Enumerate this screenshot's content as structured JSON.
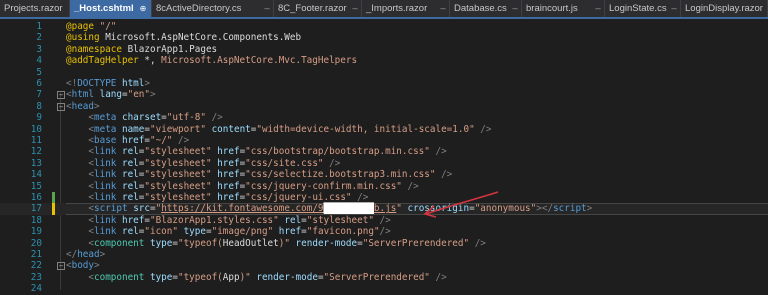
{
  "tabs": [
    {
      "label": "Projects.razor",
      "active": false
    },
    {
      "label": "_Host.cshtml",
      "active": true
    },
    {
      "label": "8cActiveDirectory.cs",
      "active": false
    },
    {
      "label": "8C_Footer.razor",
      "active": false
    },
    {
      "label": "_Imports.razor",
      "active": false
    },
    {
      "label": "Database.cs",
      "active": false
    },
    {
      "label": "braincourt.js",
      "active": false
    },
    {
      "label": "LoginState.cs",
      "active": false
    },
    {
      "label": "LoginDisplay.razor",
      "active": false
    }
  ],
  "tab_icons": {
    "pin": "⊕",
    "close": "✕",
    "separator": "–"
  },
  "colors": {
    "razor_directive": "#e8c100",
    "keyword": "#569cd6",
    "attribute": "#9cdcfe",
    "string": "#d69d85",
    "tag_bracket": "#808080",
    "component": "#4ec9b0",
    "text": "#dcdcdc",
    "line_number": "#2b91af",
    "annotation_arrow": "#d3343e"
  },
  "code_lines": [
    {
      "n": "1",
      "chg": "",
      "fold": "",
      "tokens": [
        [
          "@page",
          "d"
        ],
        [
          " \"/\"",
          "s"
        ]
      ]
    },
    {
      "n": "2",
      "chg": "",
      "fold": "",
      "tokens": [
        [
          "@using",
          "d"
        ],
        [
          " Microsoft.AspNetCore.Components.Web",
          "t"
        ]
      ]
    },
    {
      "n": "3",
      "chg": "",
      "fold": "",
      "tokens": [
        [
          "@namespace",
          "d"
        ],
        [
          " BlazorApp1.Pages",
          "t"
        ]
      ]
    },
    {
      "n": "4",
      "chg": "",
      "fold": "",
      "tokens": [
        [
          "@addTagHelper",
          "d"
        ],
        [
          " *, ",
          "t"
        ],
        [
          "Microsoft.AspNetCore.Mvc.TagHelpers",
          "s"
        ]
      ]
    },
    {
      "n": "5",
      "chg": "",
      "fold": "",
      "tokens": []
    },
    {
      "n": "6",
      "chg": "",
      "fold": "",
      "tokens": [
        [
          "<!",
          "p"
        ],
        [
          "DOCTYPE",
          "k"
        ],
        [
          " html",
          "a"
        ],
        [
          ">",
          "p"
        ]
      ]
    },
    {
      "n": "7",
      "chg": "",
      "fold": "−",
      "tokens": [
        [
          "<",
          "p"
        ],
        [
          "html",
          "k"
        ],
        [
          " lang",
          "a"
        ],
        [
          "=",
          "t"
        ],
        [
          "\"en\"",
          "s"
        ],
        [
          ">",
          "p"
        ]
      ]
    },
    {
      "n": "8",
      "chg": "",
      "fold": "−",
      "tokens": [
        [
          "<",
          "p"
        ],
        [
          "head",
          "k"
        ],
        [
          ">",
          "p"
        ]
      ]
    },
    {
      "n": "9",
      "chg": "",
      "fold": "",
      "tokens": [
        [
          "    ",
          "t"
        ],
        [
          "<",
          "p"
        ],
        [
          "meta",
          "k"
        ],
        [
          " charset",
          "a"
        ],
        [
          "=",
          "t"
        ],
        [
          "\"utf-8\"",
          "s"
        ],
        [
          " />",
          "p"
        ]
      ]
    },
    {
      "n": "10",
      "chg": "",
      "fold": "",
      "tokens": [
        [
          "    ",
          "t"
        ],
        [
          "<",
          "p"
        ],
        [
          "meta",
          "k"
        ],
        [
          " name",
          "a"
        ],
        [
          "=",
          "t"
        ],
        [
          "\"viewport\"",
          "s"
        ],
        [
          " content",
          "a"
        ],
        [
          "=",
          "t"
        ],
        [
          "\"width=device-width, initial-scale=1.0\"",
          "s"
        ],
        [
          " />",
          "p"
        ]
      ]
    },
    {
      "n": "11",
      "chg": "",
      "fold": "",
      "tokens": [
        [
          "    ",
          "t"
        ],
        [
          "<",
          "p"
        ],
        [
          "base",
          "k"
        ],
        [
          " href",
          "a"
        ],
        [
          "=",
          "t"
        ],
        [
          "\"~/\"",
          "s"
        ],
        [
          " />",
          "p"
        ]
      ]
    },
    {
      "n": "12",
      "chg": "",
      "fold": "",
      "tokens": [
        [
          "    ",
          "t"
        ],
        [
          "<",
          "p"
        ],
        [
          "link",
          "k"
        ],
        [
          " rel",
          "a"
        ],
        [
          "=",
          "t"
        ],
        [
          "\"stylesheet\"",
          "s"
        ],
        [
          " href",
          "a"
        ],
        [
          "=",
          "t"
        ],
        [
          "\"css/bootstrap/bootstrap.min.css\"",
          "s"
        ],
        [
          " />",
          "p"
        ]
      ]
    },
    {
      "n": "13",
      "chg": "",
      "fold": "",
      "tokens": [
        [
          "    ",
          "t"
        ],
        [
          "<",
          "p"
        ],
        [
          "link",
          "k"
        ],
        [
          " rel",
          "a"
        ],
        [
          "=",
          "t"
        ],
        [
          "\"stylesheet\"",
          "s"
        ],
        [
          " href",
          "a"
        ],
        [
          "=",
          "t"
        ],
        [
          "\"css/site.css\"",
          "s"
        ],
        [
          " />",
          "p"
        ]
      ]
    },
    {
      "n": "14",
      "chg": "",
      "fold": "",
      "tokens": [
        [
          "    ",
          "t"
        ],
        [
          "<",
          "p"
        ],
        [
          "link",
          "k"
        ],
        [
          " rel",
          "a"
        ],
        [
          "=",
          "t"
        ],
        [
          "\"stylesheet\"",
          "s"
        ],
        [
          " href",
          "a"
        ],
        [
          "=",
          "t"
        ],
        [
          "\"css/selectize.bootstrap3.min.css\"",
          "s"
        ],
        [
          " />",
          "p"
        ]
      ]
    },
    {
      "n": "15",
      "chg": "",
      "fold": "",
      "tokens": [
        [
          "    ",
          "t"
        ],
        [
          "<",
          "p"
        ],
        [
          "link",
          "k"
        ],
        [
          " rel",
          "a"
        ],
        [
          "=",
          "t"
        ],
        [
          "\"stylesheet\"",
          "s"
        ],
        [
          " href",
          "a"
        ],
        [
          "=",
          "t"
        ],
        [
          "\"css/jquery-confirm.min.css\"",
          "s"
        ],
        [
          " />",
          "p"
        ]
      ]
    },
    {
      "n": "16",
      "chg": "saved",
      "fold": "",
      "tokens": [
        [
          "    ",
          "t"
        ],
        [
          "<",
          "p"
        ],
        [
          "link",
          "k"
        ],
        [
          " rel",
          "a"
        ],
        [
          "=",
          "t"
        ],
        [
          "\"stylesheet\"",
          "s"
        ],
        [
          " href",
          "a"
        ],
        [
          "=",
          "t"
        ],
        [
          "\"css/jquery-ui.css\"",
          "s"
        ],
        [
          " />",
          "p"
        ]
      ]
    },
    {
      "n": "17",
      "chg": "unsaved",
      "fold": "",
      "current": true,
      "tokens": [
        [
          "    ",
          "t"
        ],
        [
          "<",
          "p"
        ],
        [
          "script",
          "k"
        ],
        [
          " src",
          "a"
        ],
        [
          "=",
          "t"
        ],
        [
          "\"",
          "s"
        ],
        [
          "https://kit.fontawesome.com/9",
          "u"
        ],
        [
          "█████████",
          "x"
        ],
        [
          "b.js",
          "u"
        ],
        [
          "\"",
          "s"
        ],
        [
          " crossorigin",
          "a"
        ],
        [
          "=",
          "t"
        ],
        [
          "\"anonymous\"",
          "s"
        ],
        [
          "></",
          "p"
        ],
        [
          "script",
          "k"
        ],
        [
          ">",
          "p"
        ]
      ]
    },
    {
      "n": "18",
      "chg": "",
      "fold": "",
      "tokens": [
        [
          "    ",
          "t"
        ],
        [
          "<",
          "p"
        ],
        [
          "link",
          "k"
        ],
        [
          " href",
          "a"
        ],
        [
          "=",
          "t"
        ],
        [
          "\"BlazorApp1.styles.css\"",
          "s"
        ],
        [
          " rel",
          "a"
        ],
        [
          "=",
          "t"
        ],
        [
          "\"stylesheet\"",
          "s"
        ],
        [
          " />",
          "p"
        ]
      ]
    },
    {
      "n": "19",
      "chg": "",
      "fold": "",
      "tokens": [
        [
          "    ",
          "t"
        ],
        [
          "<",
          "p"
        ],
        [
          "link",
          "k"
        ],
        [
          " rel",
          "a"
        ],
        [
          "=",
          "t"
        ],
        [
          "\"icon\"",
          "s"
        ],
        [
          " type",
          "a"
        ],
        [
          "=",
          "t"
        ],
        [
          "\"image/png\"",
          "s"
        ],
        [
          " href",
          "a"
        ],
        [
          "=",
          "t"
        ],
        [
          "\"favicon.png\"",
          "s"
        ],
        [
          "/>",
          "p"
        ]
      ]
    },
    {
      "n": "20",
      "chg": "",
      "fold": "",
      "tokens": [
        [
          "    ",
          "t"
        ],
        [
          "<",
          "p"
        ],
        [
          "component",
          "c"
        ],
        [
          " type",
          "a"
        ],
        [
          "=",
          "t"
        ],
        [
          "\"typeof(",
          "s"
        ],
        [
          "HeadOutlet",
          "t"
        ],
        [
          ")\"",
          "s"
        ],
        [
          " render-mode",
          "a"
        ],
        [
          "=",
          "t"
        ],
        [
          "\"ServerPrerendered\"",
          "s"
        ],
        [
          " />",
          "p"
        ]
      ]
    },
    {
      "n": "21",
      "chg": "",
      "fold": "",
      "tokens": [
        [
          "</",
          "p"
        ],
        [
          "head",
          "k"
        ],
        [
          ">",
          "p"
        ]
      ]
    },
    {
      "n": "22",
      "chg": "",
      "fold": "−",
      "tokens": [
        [
          "<",
          "p"
        ],
        [
          "body",
          "k"
        ],
        [
          ">",
          "p"
        ]
      ]
    },
    {
      "n": "23",
      "chg": "",
      "fold": "",
      "tokens": [
        [
          "    ",
          "t"
        ],
        [
          "<",
          "p"
        ],
        [
          "component",
          "c"
        ],
        [
          " type",
          "a"
        ],
        [
          "=",
          "t"
        ],
        [
          "\"typeof(",
          "s"
        ],
        [
          "App",
          "t"
        ],
        [
          ")\"",
          "s"
        ],
        [
          " render-mode",
          "a"
        ],
        [
          "=",
          "t"
        ],
        [
          "\"ServerPrerendered\"",
          "s"
        ],
        [
          " />",
          "p"
        ]
      ]
    },
    {
      "n": "24",
      "chg": "",
      "fold": "",
      "tokens": []
    }
  ]
}
